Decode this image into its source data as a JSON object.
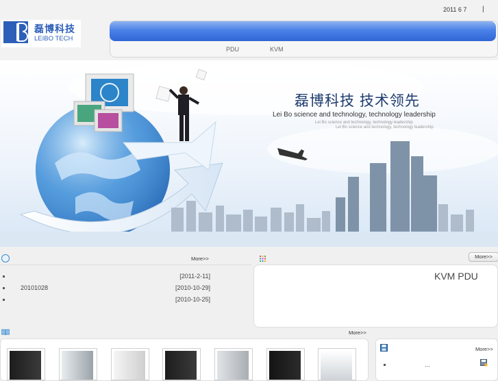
{
  "header": {
    "date": "2011 6 7",
    "separator": "|",
    "logo": {
      "name_cn": "磊博科技",
      "name_en": "LEIBO TECH",
      "icon": "leibo-logo-icon"
    }
  },
  "nav": {
    "items": [
      {
        "label": "PDU"
      },
      {
        "label": "KVM"
      }
    ]
  },
  "banner": {
    "title_cn": "磊博科技  技术领先",
    "title_en": "Lei Bo science and technology, technology leadership",
    "sub1": "Lei Bo science and technology, technology leadership",
    "sub2": "Lei Bo science and technology, technology leadership"
  },
  "news": {
    "icon": "plus-circle-icon",
    "more": "More>>",
    "items": [
      {
        "title": "",
        "date": "[2011-2-11]"
      },
      {
        "title": "20101028",
        "date": "[2010-10-29]"
      },
      {
        "title": "",
        "date": "[2010-10-25]"
      }
    ]
  },
  "products": {
    "icon": "grid-dots-icon",
    "more": "More>>",
    "text": "KVM PDU"
  },
  "gallery": {
    "icon": "book-icon",
    "more": "More>>",
    "items": [
      {
        "name": "rack-cabinet-1",
        "color": "#2b2b2b"
      },
      {
        "name": "rack-cabinet-2",
        "color": "#9aa3aa"
      },
      {
        "name": "rack-cabinet-3",
        "color": "#d6d6d6"
      },
      {
        "name": "rack-cabinet-4",
        "color": "#2b2b2b"
      },
      {
        "name": "rack-cabinet-5",
        "color": "#a9aeb3"
      },
      {
        "name": "rack-cabinet-6",
        "color": "#1f1f1f"
      },
      {
        "name": "rack-cabinet-7",
        "color": "#cfd4d9"
      }
    ]
  },
  "downloads": {
    "icon": "floppy-icon",
    "more": "More>>",
    "item": "...",
    "save_icon": "save-icon"
  },
  "colors": {
    "nav_gradient_top": "#8fb3f0",
    "nav_gradient_bottom": "#2f66d6",
    "brand": "#2d5fb8"
  }
}
